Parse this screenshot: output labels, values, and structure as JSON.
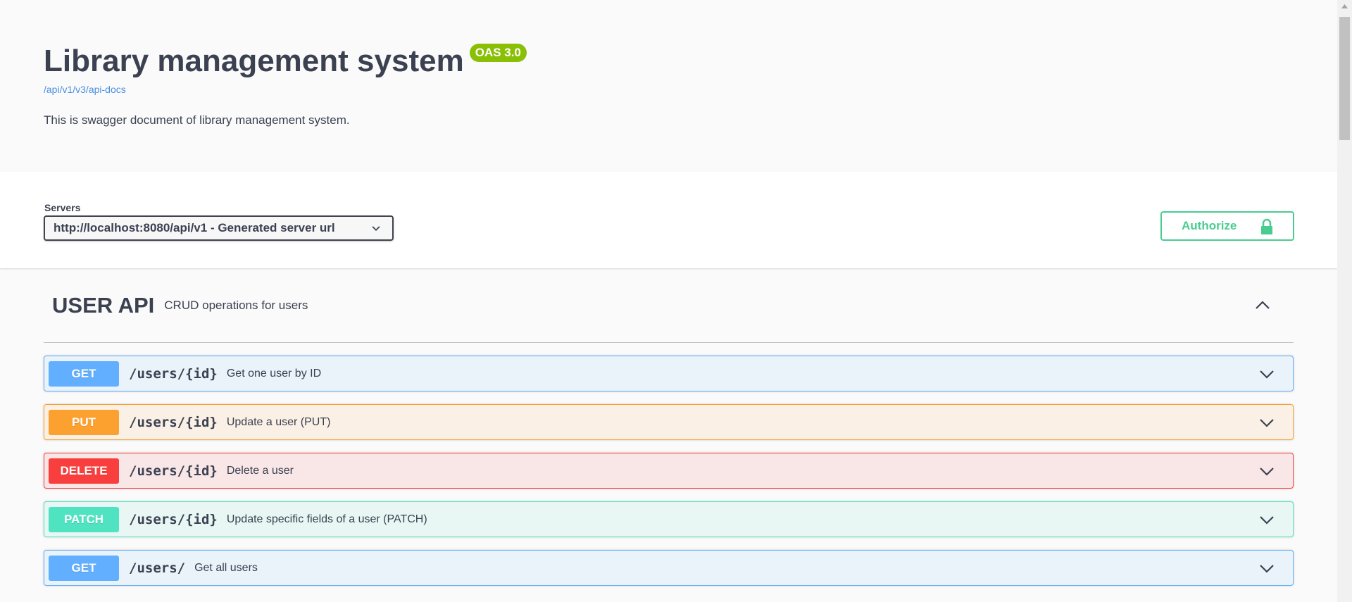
{
  "info": {
    "title": "Library management system",
    "version_badge": "OAS 3.0",
    "doc_url": "/api/v1/v3/api-docs",
    "description": "This is swagger document of library management system."
  },
  "servers": {
    "label": "Servers",
    "selected": "http://localhost:8080/api/v1 - Generated server url"
  },
  "authorize": {
    "label": "Authorize",
    "icon": "lock-icon"
  },
  "tag": {
    "name": "USER API",
    "description": "CRUD operations for users",
    "expanded": true
  },
  "operations": [
    {
      "method": "GET",
      "path": "/users/{id}",
      "summary": "Get one user by ID"
    },
    {
      "method": "PUT",
      "path": "/users/{id}",
      "summary": "Update a user (PUT)"
    },
    {
      "method": "DELETE",
      "path": "/users/{id}",
      "summary": "Delete a user"
    },
    {
      "method": "PATCH",
      "path": "/users/{id}",
      "summary": "Update specific fields of a user (PATCH)"
    },
    {
      "method": "GET",
      "path": "/users/",
      "summary": "Get all users"
    }
  ],
  "colors": {
    "get": "#61affe",
    "put": "#fca130",
    "delete": "#f93e3e",
    "patch": "#50e3c2",
    "authorize": "#49cc90",
    "badge": "#89bf04",
    "link": "#4990e2"
  }
}
